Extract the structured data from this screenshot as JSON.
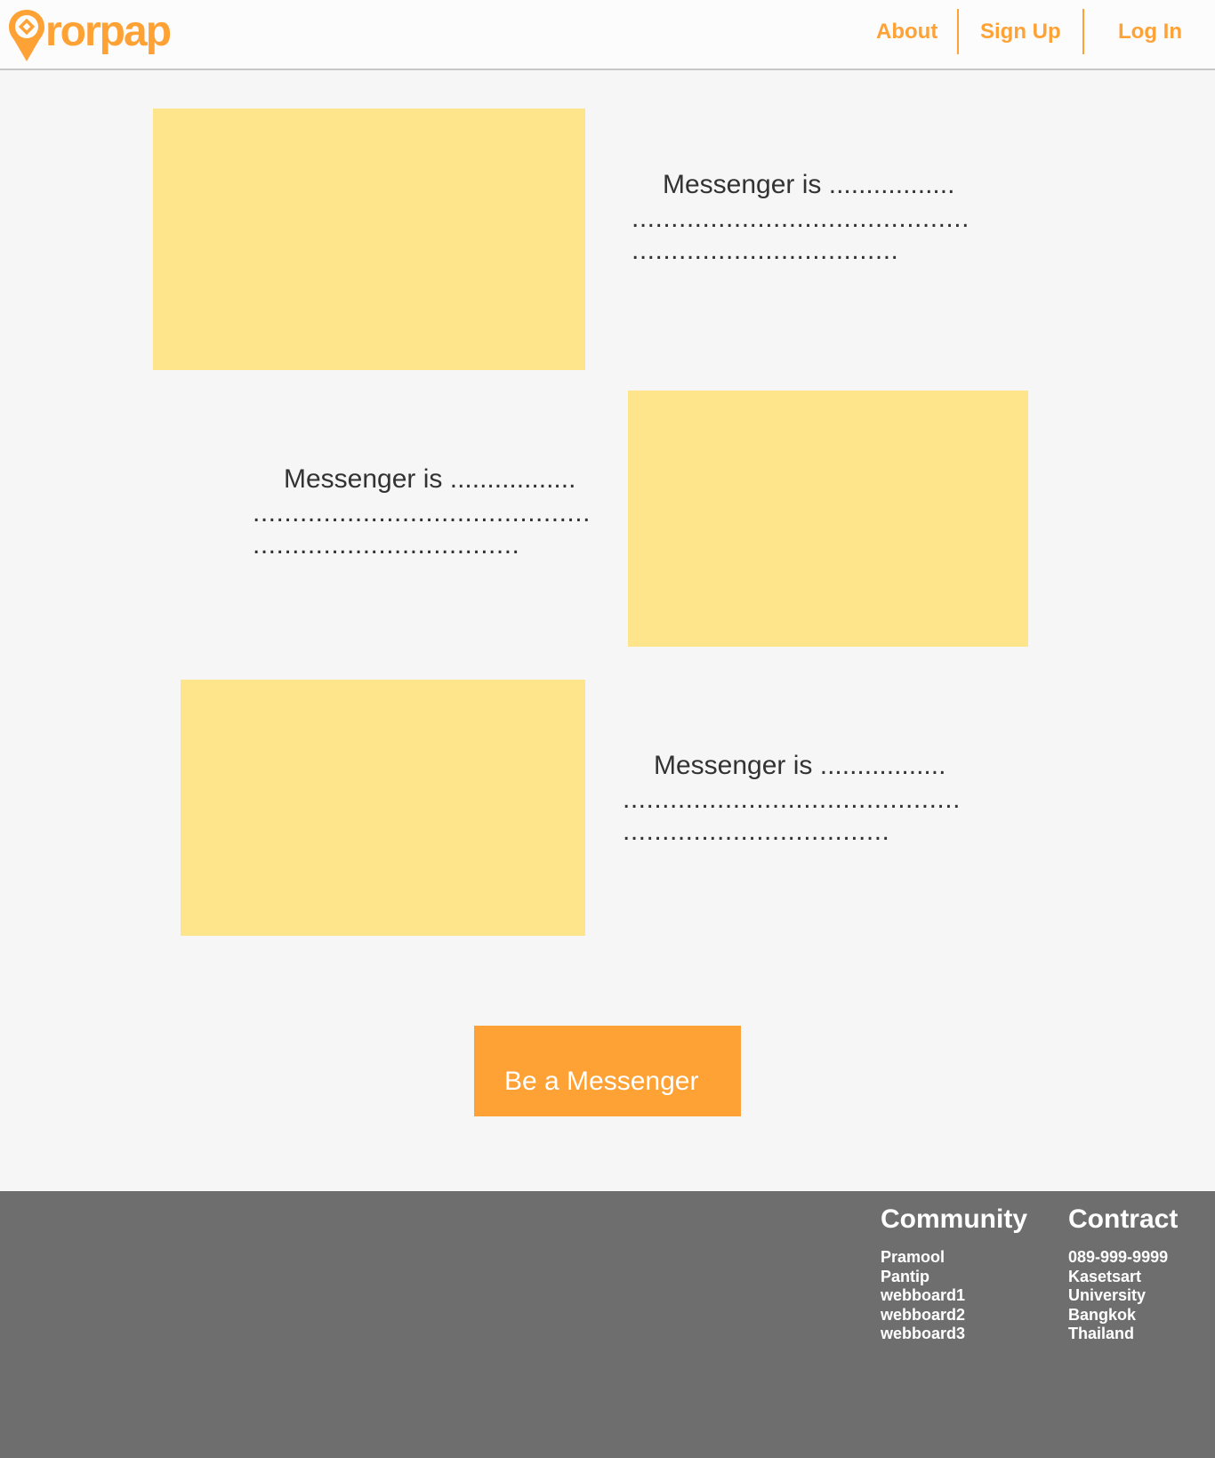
{
  "brand": {
    "name": "rorpap",
    "accent": "#ffa236",
    "logo_icon": "map-pin-icon"
  },
  "nav": {
    "about": "About",
    "signup": "Sign Up",
    "login": "Log In"
  },
  "sections": [
    {
      "heading": "Messenger is .................",
      "line2": "...........................................",
      "line3": ".................................."
    },
    {
      "heading": "Messenger is .................",
      "line2": "...........................................",
      "line3": ".................................."
    },
    {
      "heading": "Messenger is .................",
      "line2": "...........................................",
      "line3": ".................................."
    }
  ],
  "cta": {
    "label": "Be a Messenger"
  },
  "footer": {
    "community": {
      "title": "Community",
      "items": [
        "Pramool",
        "Pantip",
        "webboard1",
        "webboard2",
        "webboard3"
      ]
    },
    "contract": {
      "title": "Contract",
      "items": [
        "089-999-9999",
        "Kasetsart",
        "University",
        "Bangkok",
        "Thailand"
      ]
    }
  },
  "colors": {
    "image_placeholder": "#fee58b",
    "footer_bg": "#6e6e6e",
    "page_bg": "#f6f6f6"
  }
}
